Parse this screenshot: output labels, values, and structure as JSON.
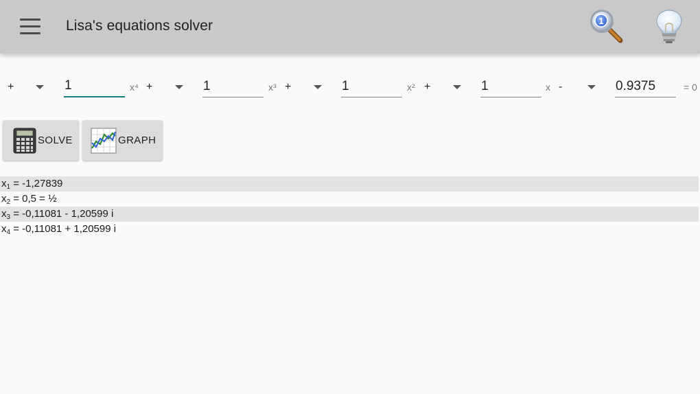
{
  "appbar": {
    "title": "Lisa's equations solver",
    "menu_icon": "hamburger-menu-icon",
    "actions": [
      {
        "name": "search-one-icon",
        "badge": "1"
      },
      {
        "name": "lightbulb-icon"
      }
    ]
  },
  "equation": {
    "terms": [
      {
        "sign": "+",
        "value": "1",
        "power": "x⁴"
      },
      {
        "sign": "+",
        "value": "1",
        "power": "x³"
      },
      {
        "sign": "+",
        "value": "1",
        "power": "x²"
      },
      {
        "sign": "+",
        "value": "1",
        "power": "x"
      },
      {
        "sign": "-",
        "value": "0.9375",
        "power": "= 0"
      }
    ]
  },
  "buttons": {
    "solve_label": "SOLVE",
    "graph_label": "GRAPH"
  },
  "results": [
    {
      "var": "x",
      "sub": "1",
      "text": " = -1,27839"
    },
    {
      "var": "x",
      "sub": "2",
      "text": " = 0,5 = ½"
    },
    {
      "var": "x",
      "sub": "3",
      "text": " = -0,11081 - 1,20599 i"
    },
    {
      "var": "x",
      "sub": "4",
      "text": " = -0,11081 + 1,20599 i"
    }
  ],
  "colors": {
    "appbar": "#c9c9c9",
    "accent": "#127f78",
    "row_shade": "#e2e2e2",
    "background": "#fafafa"
  }
}
